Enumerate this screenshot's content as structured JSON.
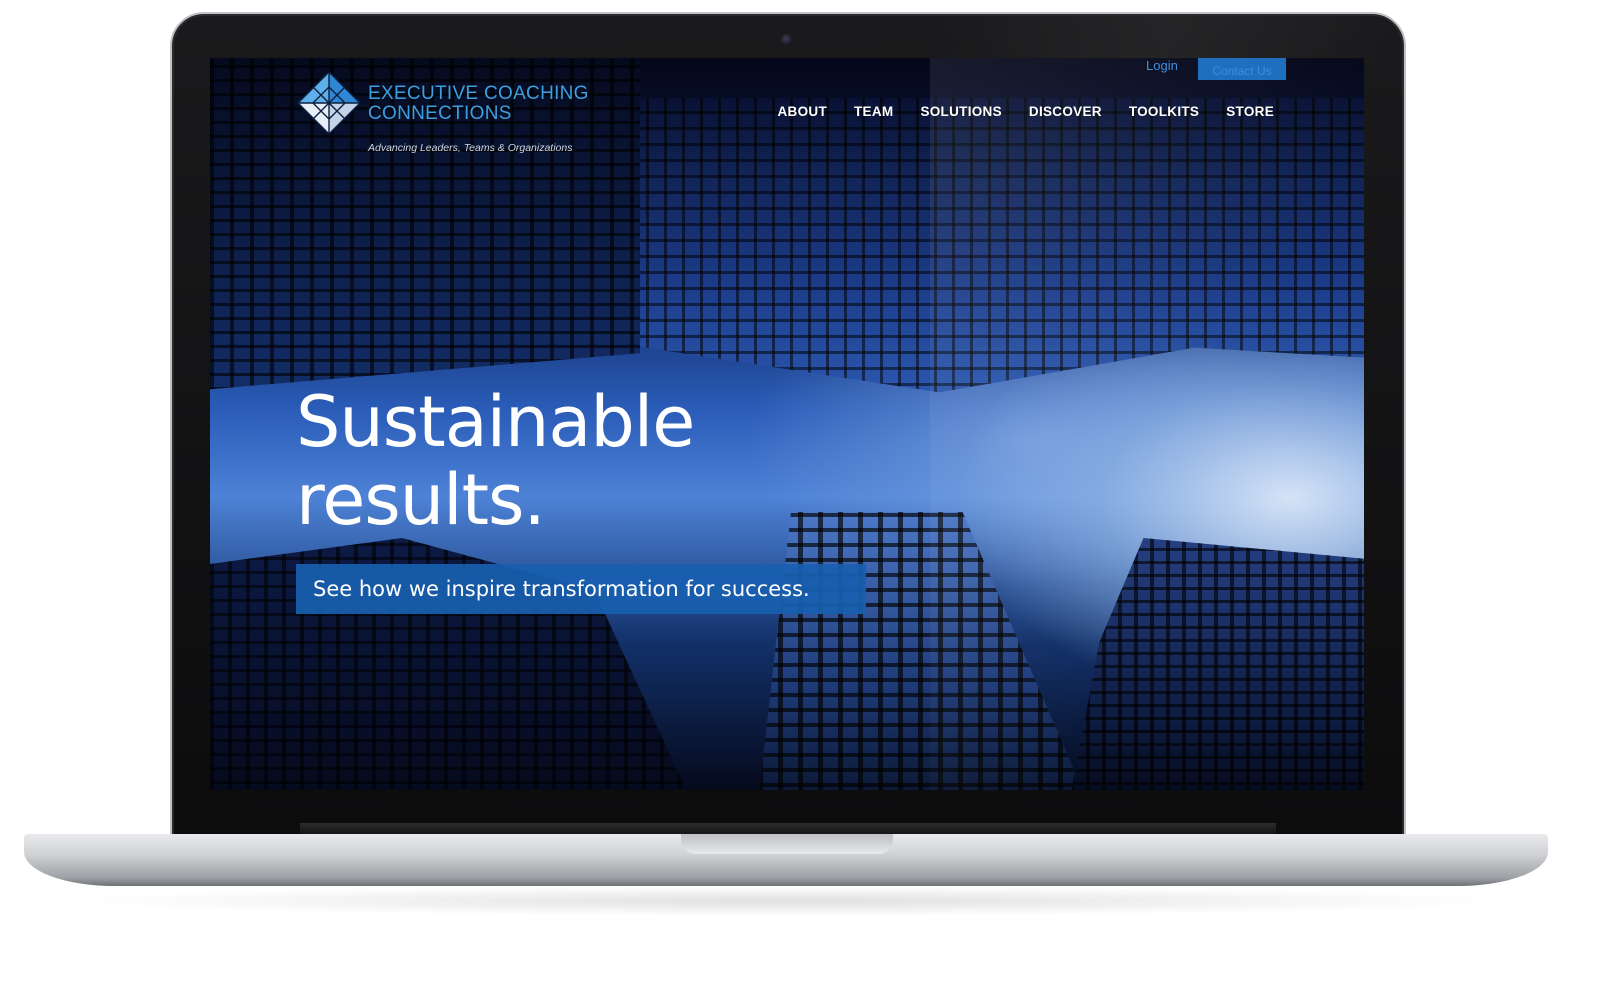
{
  "site": {
    "logo": {
      "title_line1": "EXECUTIVE COACHING",
      "title_line2": "CONNECTIONS",
      "tagline": "Advancing Leaders, Teams & Organizations"
    },
    "utility_nav": {
      "login": "Login",
      "contact": "Contact Us"
    },
    "main_nav": [
      {
        "label": "ABOUT"
      },
      {
        "label": "TEAM"
      },
      {
        "label": "SOLUTIONS"
      },
      {
        "label": "DISCOVER"
      },
      {
        "label": "TOOLKITS"
      },
      {
        "label": "STORE"
      }
    ],
    "hero": {
      "heading_line1": "Sustainable",
      "heading_line2": "results.",
      "cta": "See how we inspire transformation for success."
    }
  },
  "colors": {
    "brand_blue": "#3d9ee0",
    "cta_blue": "#1860b0",
    "contact_button_blue": "#1f6fbf"
  }
}
